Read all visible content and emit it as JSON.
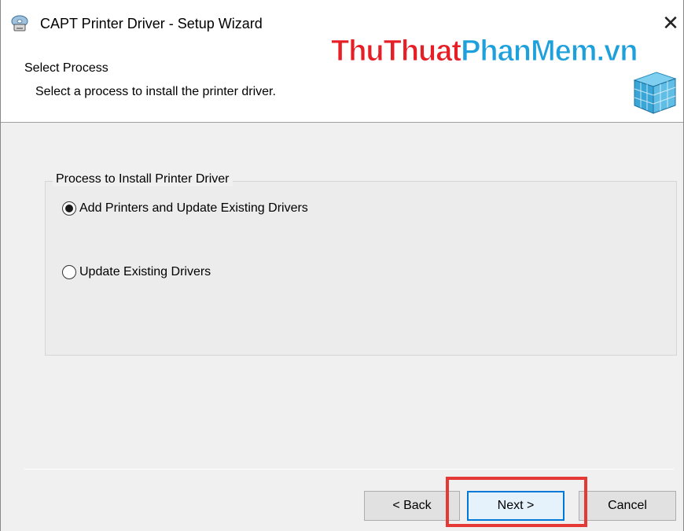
{
  "window": {
    "title": "CAPT Printer Driver - Setup Wizard",
    "icon": "printer-disc-icon"
  },
  "header": {
    "title": "Select Process",
    "subtitle": "Select a process to install the printer driver."
  },
  "watermark": {
    "part1": "ThuThuat",
    "part2": "PhanMem",
    "part3": ".vn",
    "color1": "#e61e25",
    "color2": "#1ea0dc"
  },
  "group": {
    "legend": "Process to Install Printer Driver",
    "options": [
      {
        "label": "Add Printers and Update Existing Drivers",
        "selected": true
      },
      {
        "label": "Update Existing Drivers",
        "selected": false
      }
    ]
  },
  "buttons": {
    "back": "< Back",
    "next": "Next >",
    "cancel": "Cancel"
  },
  "colors": {
    "highlight": "#e53935",
    "focus": "#0078d7"
  }
}
